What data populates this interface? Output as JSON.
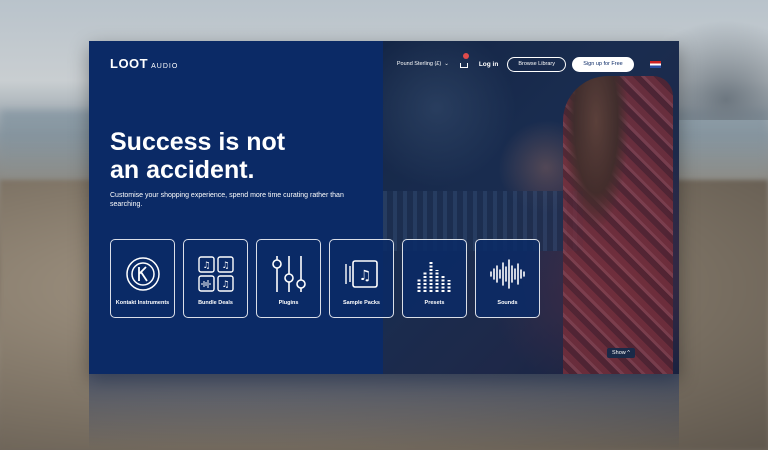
{
  "logo": {
    "brand": "LOOT",
    "suffix": "AUDIO"
  },
  "nav": {
    "currency": "Pound Sterling (£)",
    "login": "Log in",
    "browse": "Browse Library",
    "signup": "Sign up for Free"
  },
  "hero": {
    "line1": "Success is not",
    "line2": "an accident.",
    "subtitle": "Customise your shopping experience, spend more time curating rather than searching."
  },
  "categories": [
    {
      "label": "Kontakt Instruments",
      "icon": "kontakt-icon"
    },
    {
      "label": "Bundle Deals",
      "icon": "bundle-icon"
    },
    {
      "label": "Plugins",
      "icon": "sliders-icon"
    },
    {
      "label": "Sample Packs",
      "icon": "sample-pack-icon"
    },
    {
      "label": "Presets",
      "icon": "presets-icon"
    },
    {
      "label": "Sounds",
      "icon": "waveform-icon"
    }
  ],
  "show_label": "Show ^",
  "colors": {
    "primary": "#0b2a66",
    "badge": "#e04b4b"
  }
}
